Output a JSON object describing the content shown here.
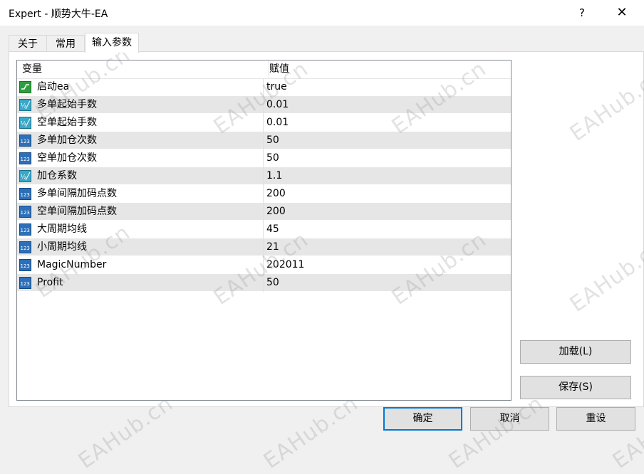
{
  "window": {
    "title": "Expert - 顺势大牛-EA",
    "help_glyph": "?",
    "close_glyph": "✕"
  },
  "tabs": [
    {
      "label": "关于",
      "active": false
    },
    {
      "label": "常用",
      "active": false
    },
    {
      "label": "输入参数",
      "active": true
    }
  ],
  "grid": {
    "columns": [
      "变量",
      "赋值"
    ],
    "rows": [
      {
        "name": "启动ea",
        "value": "true",
        "icon": "bool-icon"
      },
      {
        "name": "多单起始手数",
        "value": "0.01",
        "icon": "double-icon"
      },
      {
        "name": "空单起始手数",
        "value": "0.01",
        "icon": "double-icon"
      },
      {
        "name": "多单加仓次数",
        "value": "50",
        "icon": "integer-icon"
      },
      {
        "name": "空单加仓次数",
        "value": "50",
        "icon": "integer-icon"
      },
      {
        "name": "加仓系数",
        "value": "1.1",
        "icon": "double-icon"
      },
      {
        "name": "多单间隔加码点数",
        "value": "200",
        "icon": "integer-icon"
      },
      {
        "name": "空单间隔加码点数",
        "value": "200",
        "icon": "integer-icon"
      },
      {
        "name": "大周期均线",
        "value": "45",
        "icon": "integer-icon"
      },
      {
        "name": "小周期均线",
        "value": "21",
        "icon": "integer-icon"
      },
      {
        "name": "MagicNumber",
        "value": "202011",
        "icon": "integer-icon"
      },
      {
        "name": "Profit",
        "value": "50",
        "icon": "integer-icon"
      }
    ]
  },
  "buttons": {
    "load": "加载(L)",
    "save": "保存(S)",
    "ok": "确定",
    "cancel": "取消",
    "reset": "重设"
  },
  "watermark": "EAHub.cn",
  "colors": {
    "accent": "#0078d7",
    "row_alt": "#e6e6e6"
  }
}
